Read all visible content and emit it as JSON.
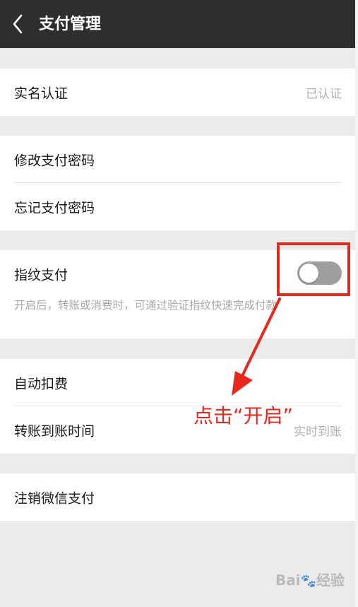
{
  "navbar": {
    "title": "支付管理",
    "back_icon": "chevron-left-icon"
  },
  "groups": {
    "identity": {
      "label": "实名认证",
      "value": "已认证"
    },
    "password": {
      "change_label": "修改支付密码",
      "forgot_label": "忘记支付密码"
    },
    "fingerprint": {
      "label": "指纹支付",
      "enabled": false,
      "description": "开启后，转账或消费时，可通过验证指纹快速完成付款"
    },
    "deduction": {
      "auto_label": "自动扣费",
      "transfer_label": "转账到账时间",
      "transfer_value": "实时到账"
    },
    "cancel": {
      "label": "注销微信支付"
    }
  },
  "annotation": {
    "text": "点击“开启”",
    "color": "#e8271d"
  },
  "watermark": {
    "text": "Bai",
    "paw": "🐾",
    "suffix": "经验"
  },
  "colors": {
    "navbar_bg": "#2e2e2e",
    "page_bg": "#ebebeb",
    "toggle_off": "#9e9e9e"
  }
}
